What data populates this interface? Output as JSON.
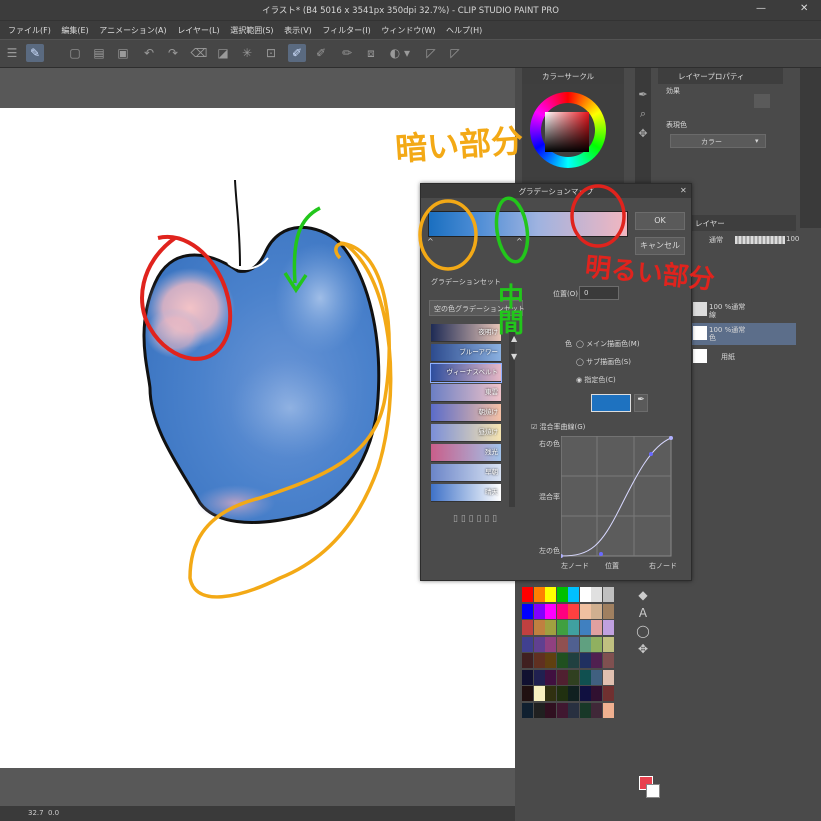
{
  "window": {
    "title": "イラスト* (B4 5016 x 3541px 350dpi 32.7%) - CLIP STUDIO PAINT PRO",
    "minimize": "—",
    "close": "✕"
  },
  "menu": [
    "ファイル(F)",
    "編集(E)",
    "アニメーション(A)",
    "レイヤー(L)",
    "選択範囲(S)",
    "表示(V)",
    "フィルター(I)",
    "ウィンドウ(W)",
    "ヘルプ(H)"
  ],
  "status": {
    "zoom": "32.7",
    "angle": "0.0"
  },
  "color_panel": {
    "title": "カラーサークル"
  },
  "layer_property": {
    "title": "レイヤープロパティ",
    "effect_label": "効果",
    "expression_label": "表現色",
    "expression_value": "カラー"
  },
  "layer_panel": {
    "title": "レイヤー",
    "blend_mode": "通常",
    "opacity": "100",
    "layers": [
      {
        "name": "100 %通常",
        "sub": "線"
      },
      {
        "name": "100 %通常",
        "sub": "色"
      },
      {
        "name": "用紙",
        "sub": ""
      }
    ]
  },
  "dialog": {
    "title": "グラデーションマップ",
    "ok": "OK",
    "cancel": "キャンセル",
    "set_label": "グラデーションセット",
    "set_select": "空の色グラデーションセット",
    "position_label": "位置(O)",
    "position_value": "0",
    "color_label": "色",
    "color_options": [
      "メイン描画色(M)",
      "サブ描画色(S)",
      "指定色(C)"
    ],
    "selected_color": "#1e72c0",
    "curve_label": "混合率曲線(G)",
    "curve_y_top": "右の色",
    "curve_y_mid": "混合率",
    "curve_y_bottom": "左の色",
    "curve_x_left": "左ノード",
    "curve_x_mid": "位置",
    "curve_x_right": "右ノード",
    "gradient_stops": [
      "#1a6fc0",
      "#4f8ed6",
      "#9fb3e0",
      "#f2b6c0"
    ],
    "presets": [
      {
        "label": "夜明け",
        "colors": [
          "#1e2b55",
          "#e9c6b8"
        ]
      },
      {
        "label": "ブルーアワー",
        "colors": [
          "#2d4b8e",
          "#8ab0e0"
        ]
      },
      {
        "label": "ヴィーナスベルト",
        "colors": [
          "#2e4e9e",
          "#e7b8c6"
        ]
      },
      {
        "label": "東雲",
        "colors": [
          "#6b7fc4",
          "#f0c3c9"
        ]
      },
      {
        "label": "朝焼け",
        "colors": [
          "#5b6cc9",
          "#f5c1a5"
        ]
      },
      {
        "label": "昼焼け",
        "colors": [
          "#7b8fd8",
          "#f6e4b0"
        ]
      },
      {
        "label": "残光",
        "colors": [
          "#c95e8a",
          "#a1c3ea"
        ]
      },
      {
        "label": "早朝",
        "colors": [
          "#6b85c8",
          "#d9e3f3"
        ]
      },
      {
        "label": "晴天",
        "colors": [
          "#3f72c8",
          "#ffffff"
        ]
      }
    ]
  },
  "annotations": {
    "dark": "暗い部分",
    "middle": "中間",
    "light": "明るい部分",
    "color_dark": "#f3a916",
    "color_middle": "#22c61b",
    "color_light": "#e0231d"
  },
  "palette": {
    "rows": [
      [
        "#ff0000",
        "#ff8000",
        "#ffff00",
        "#00c000",
        "#00c0ff",
        "#ffffff",
        "#e0e0e0",
        "#c0c0c0"
      ],
      [
        "#0000ff",
        "#8000ff",
        "#ff00ff",
        "#ff0080",
        "#ff4040",
        "#f0c0a0",
        "#d0b090",
        "#a08060"
      ],
      [
        "#c04040",
        "#c08040",
        "#a0a040",
        "#40a040",
        "#40a0a0",
        "#4080c0",
        "#e0a0a0",
        "#c0a0e0"
      ],
      [
        "#404090",
        "#604090",
        "#904080",
        "#905050",
        "#506090",
        "#60a080",
        "#90b060",
        "#c0c080"
      ],
      [
        "#402020",
        "#603020",
        "#604010",
        "#205020",
        "#204040",
        "#203060",
        "#502050",
        "#805050"
      ],
      [
        "#101030",
        "#202050",
        "#401040",
        "#502030",
        "#304020",
        "#105050",
        "#406080",
        "#e0c0b0"
      ],
      [
        "#201010",
        "#f8f0c0",
        "#303010",
        "#203010",
        "#102020",
        "#101040",
        "#301030",
        "#703030"
      ],
      [
        "#102030",
        "#202020",
        "#301020",
        "#401830",
        "#283040",
        "#183828",
        "#402838",
        "#f0b090"
      ]
    ]
  }
}
